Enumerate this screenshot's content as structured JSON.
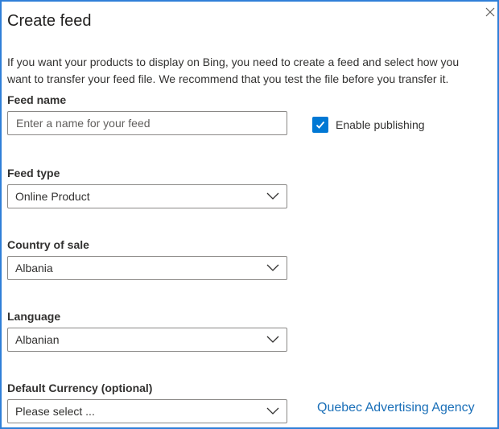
{
  "dialog": {
    "title": "Create feed",
    "description": "If you want your products to display on Bing, you need to create a feed and select how you want to transfer your feed file. We recommend that you test the file before you transfer it."
  },
  "form": {
    "feed_name": {
      "label": "Feed name",
      "placeholder": "Enter a name for your feed",
      "value": ""
    },
    "enable_publishing": {
      "label": "Enable publishing",
      "checked": true
    },
    "feed_type": {
      "label": "Feed type",
      "selected": "Online Product"
    },
    "country_of_sale": {
      "label": "Country of sale",
      "selected": "Albania"
    },
    "language": {
      "label": "Language",
      "selected": "Albanian"
    },
    "default_currency": {
      "label": "Default Currency (optional)",
      "selected": "Please select ..."
    }
  },
  "watermark": {
    "text": "Quebec Advertising Agency"
  },
  "colors": {
    "accent": "#0078d4",
    "frame_border": "#2f7fd8",
    "watermark": "#1a6fb8"
  },
  "icons": {
    "close": "close-icon",
    "dropdown": "chevron-down-icon",
    "check": "checkmark-icon"
  }
}
